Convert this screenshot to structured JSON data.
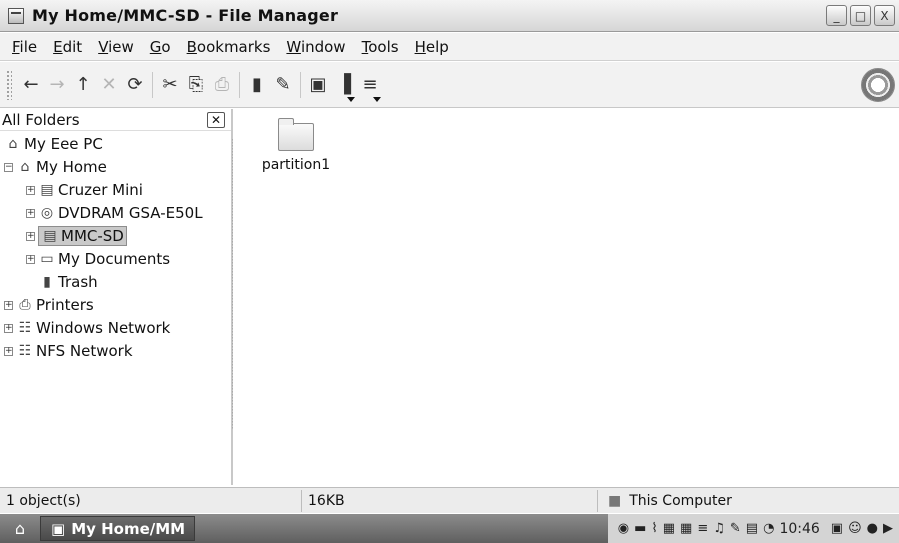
{
  "window": {
    "title": "My Home/MMC-SD - File Manager",
    "buttons": {
      "minimize": "_",
      "maximize": "□",
      "close": "X"
    }
  },
  "menu": [
    {
      "mnemonic": "F",
      "rest": "ile"
    },
    {
      "mnemonic": "E",
      "rest": "dit"
    },
    {
      "mnemonic": "V",
      "rest": "iew"
    },
    {
      "mnemonic": "G",
      "rest": "o"
    },
    {
      "mnemonic": "B",
      "rest": "ookmarks"
    },
    {
      "mnemonic": "W",
      "rest": "indow"
    },
    {
      "mnemonic": "T",
      "rest": "ools"
    },
    {
      "mnemonic": "H",
      "rest": "elp"
    }
  ],
  "toolbar": {
    "icons": {
      "back": "←",
      "forward": "→",
      "up": "↑",
      "stop": "✕",
      "reload": "⟳",
      "cut": "✂",
      "copy": "⎘",
      "paste": "⎙",
      "trash": "▮",
      "properties": "✎",
      "view_icons": "▣",
      "view_details": "▐",
      "view_list": "≡"
    }
  },
  "sidebar": {
    "header": "All Folders",
    "close": "✕",
    "items": [
      {
        "label": "My Eee PC",
        "icon": "⌂"
      },
      {
        "label": "My Home",
        "icon": "⌂",
        "expander": "−"
      },
      {
        "label": "Cruzer Mini",
        "icon": "▤",
        "expander": "+"
      },
      {
        "label": "DVDRAM GSA-E50L",
        "icon": "◎",
        "expander": "+"
      },
      {
        "label": "MMC-SD",
        "icon": "▤",
        "expander": "+"
      },
      {
        "label": "My Documents",
        "icon": "▭",
        "expander": "+"
      },
      {
        "label": "Trash",
        "icon": "▮"
      },
      {
        "label": "Printers",
        "icon": "⎙",
        "expander": "+"
      },
      {
        "label": "Windows Network",
        "icon": "☷",
        "expander": "+"
      },
      {
        "label": "NFS Network",
        "icon": "☷",
        "expander": "+"
      }
    ]
  },
  "main": {
    "files": [
      {
        "name": "partition1",
        "type": "folder"
      }
    ]
  },
  "status": {
    "count": "1 object(s)",
    "size": "16KB",
    "location": "This Computer",
    "location_icon": "■"
  },
  "taskbar": {
    "start_icon": "⌂",
    "task_label": "My Home/MM",
    "task_icon": "▣",
    "tray_icons": [
      "◉",
      "▬",
      "⌇",
      "▦",
      "▦",
      "≡",
      "♫",
      "✎",
      "▤",
      "◔"
    ],
    "clock": "10:46",
    "right_icons": [
      "▣",
      "☺",
      "●",
      "▶"
    ]
  }
}
